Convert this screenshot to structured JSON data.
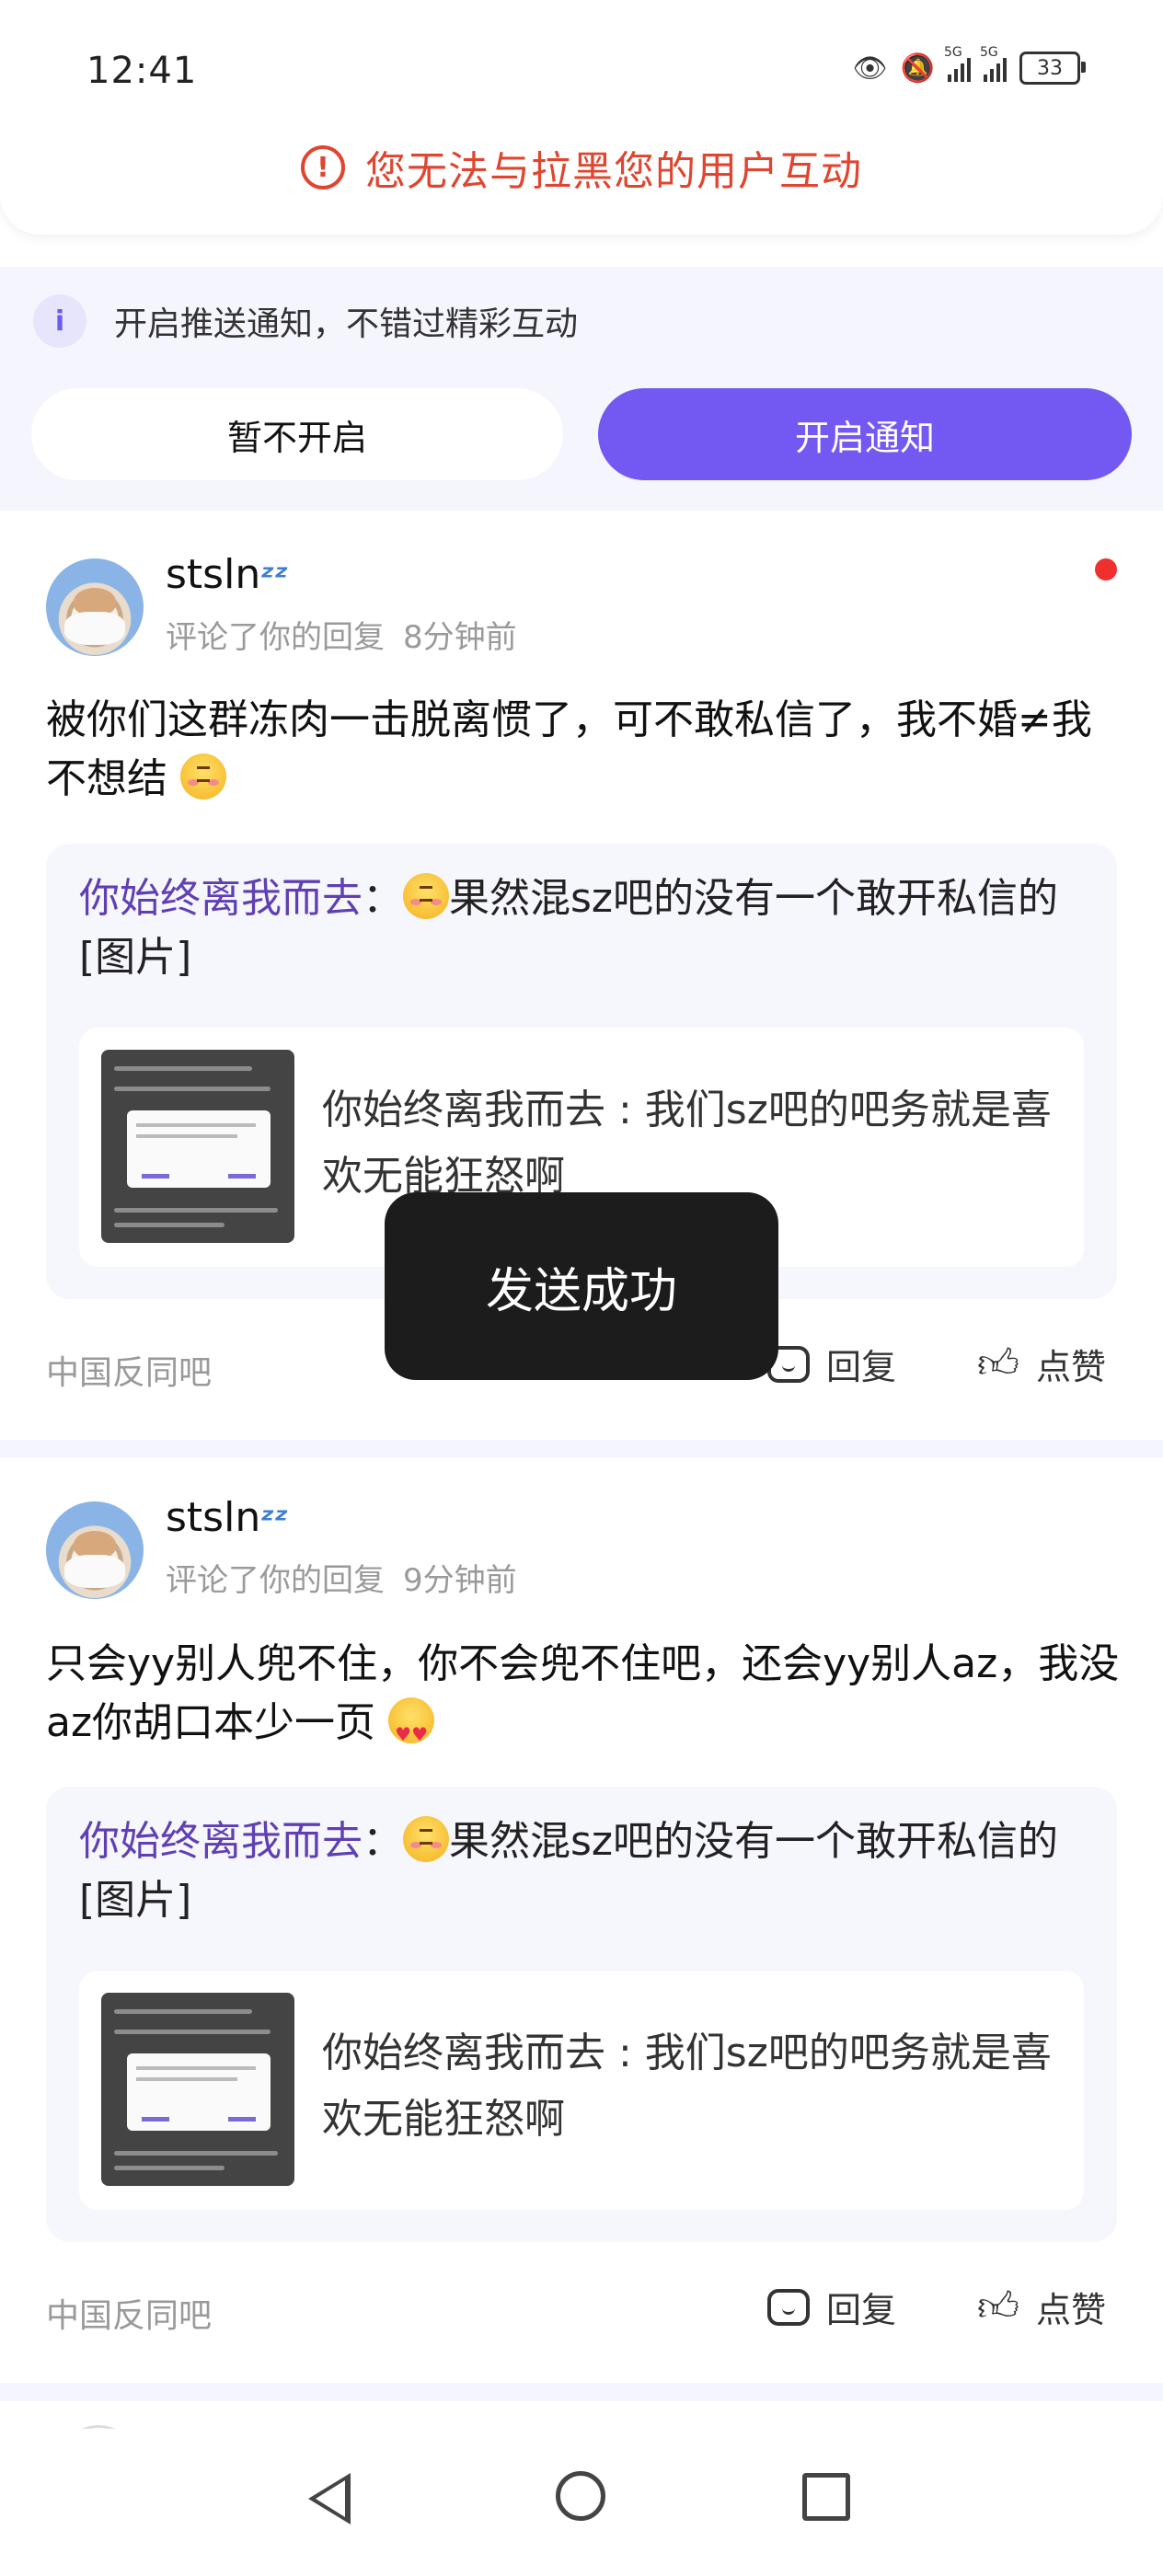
{
  "status_bar": {
    "time": "12:41",
    "battery": "33",
    "net1": "5G",
    "net2": "5G"
  },
  "banner": {
    "text": "您无法与拉黑您的用户互动"
  },
  "notify": {
    "text": "开启推送通知，不错过精彩互动",
    "later_label": "暂不开启",
    "enable_label": "开启通知"
  },
  "toast": {
    "text": "发送成功"
  },
  "items": [
    {
      "username": "stsln",
      "action": "评论了你的回复",
      "time": "8分钟前",
      "comment": "被你们这群冻肉一击脱离惯了，可不敢私信了，我不婚≠我不想结",
      "quote_user": "你始终离我而去",
      "quote_sep": "：",
      "quote_text": "果然混sz吧的没有一个敢开私信的[图片]",
      "inner_text": "你始终离我而去 : 我们sz吧的吧务就是喜欢无能狂怒啊",
      "forum": "中国反同吧",
      "reply_label": "回复",
      "like_label": "点赞"
    },
    {
      "username": "stsln",
      "action": "评论了你的回复",
      "time": "9分钟前",
      "comment": "只会yy别人兜不住，你不会兜不住吧，还会yy别人az，我没az你胡口本少一页",
      "quote_user": "你始终离我而去",
      "quote_sep": "：",
      "quote_text": "果然混sz吧的没有一个敢开私信的[图片]",
      "inner_text": "你始终离我而去 : 我们sz吧的吧务就是喜欢无能狂怒啊",
      "forum": "中国反同吧",
      "reply_label": "回复",
      "like_label": "点赞"
    }
  ],
  "icons": {
    "warning": "warning-circle-icon",
    "info": "info-icon",
    "reply": "comment-bubble-icon",
    "like": "thumbs-up-icon",
    "nav": [
      "back-triangle-icon",
      "home-circle-icon",
      "recents-square-icon"
    ]
  },
  "colors": {
    "accent": "#7358f2",
    "warning": "#e0452f",
    "quote_user": "#5f3fb3",
    "unread_dot": "#f02f2f"
  }
}
